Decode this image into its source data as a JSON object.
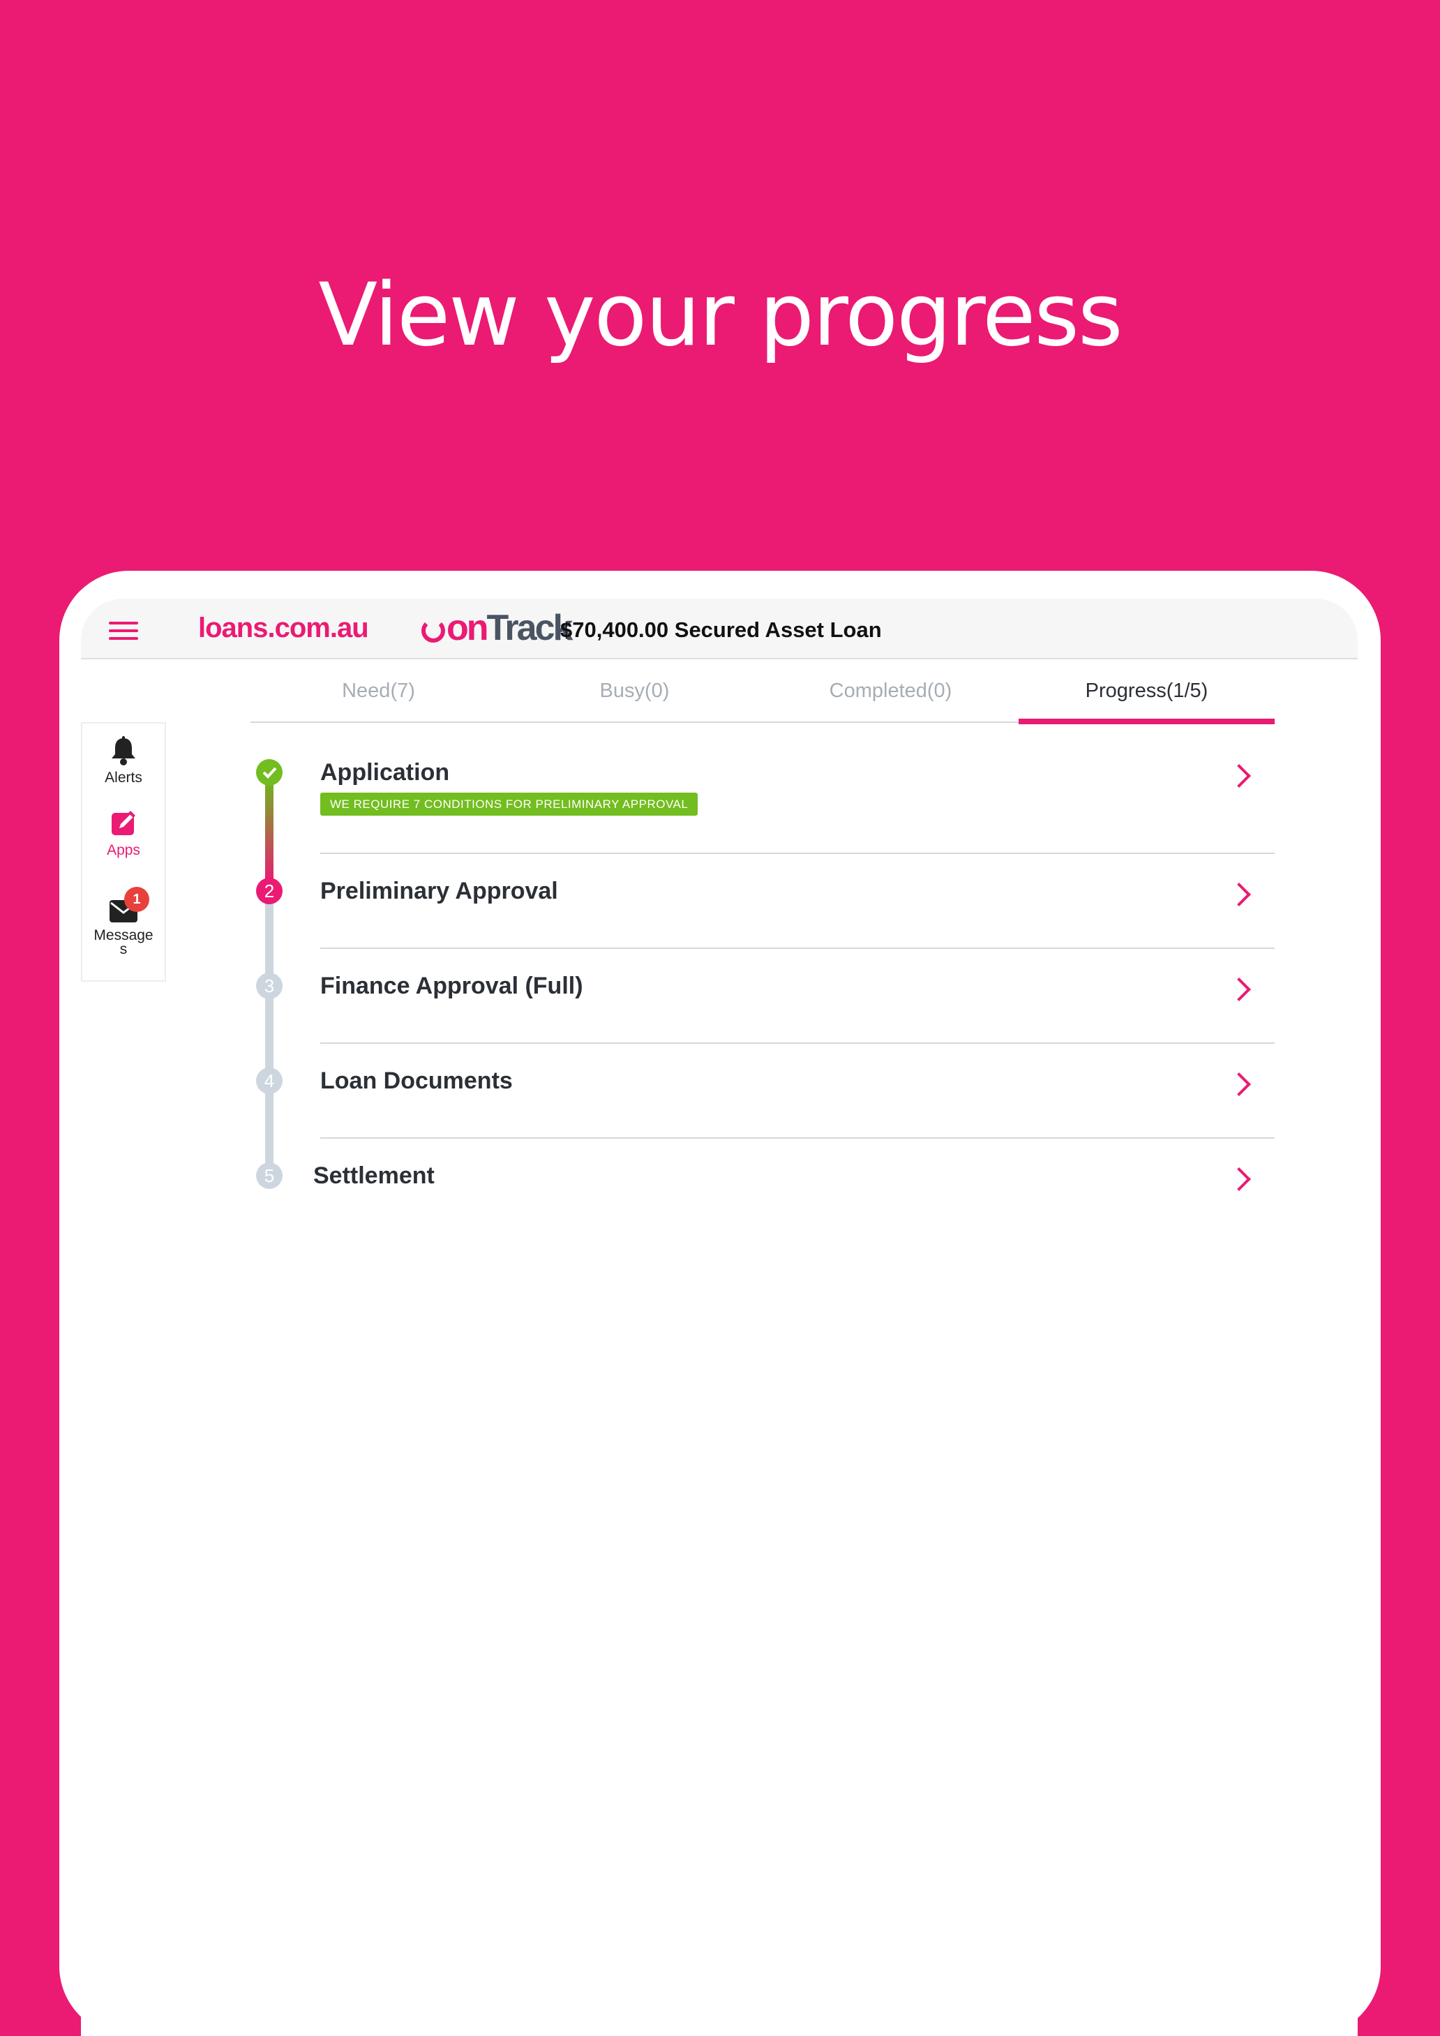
{
  "headline": "View your progress",
  "topbar": {
    "brand": "loans.com.au",
    "ontrack_on": "on",
    "ontrack_track": "Track",
    "loan_title": "$70,400.00 Secured Asset Loan"
  },
  "sidenav": {
    "items": [
      {
        "label": "Alerts",
        "icon": "bell-icon"
      },
      {
        "label": "Apps",
        "icon": "edit-icon"
      },
      {
        "label": "Message\ns",
        "icon": "envelope-icon",
        "badge": "1"
      }
    ]
  },
  "tabs": [
    {
      "label": "Need(7)"
    },
    {
      "label": "Busy(0)"
    },
    {
      "label": "Completed(0)"
    },
    {
      "label": "Progress(1/5)"
    }
  ],
  "steps": [
    {
      "number": "",
      "name": "Application",
      "status": "done",
      "condition": "WE REQUIRE 7 CONDITIONS FOR PRELIMINARY APPROVAL"
    },
    {
      "number": "2",
      "name": "Preliminary Approval",
      "status": "current"
    },
    {
      "number": "3",
      "name": "Finance Approval (Full)",
      "status": "pending"
    },
    {
      "number": "4",
      "name": "Loan Documents",
      "status": "pending"
    },
    {
      "number": "5",
      "name": "Settlement",
      "status": "pending"
    }
  ],
  "colors": {
    "brand": "#EB1A73",
    "success": "#72BD1F",
    "pending": "#CDD6DF",
    "badge": "#E8413C"
  }
}
